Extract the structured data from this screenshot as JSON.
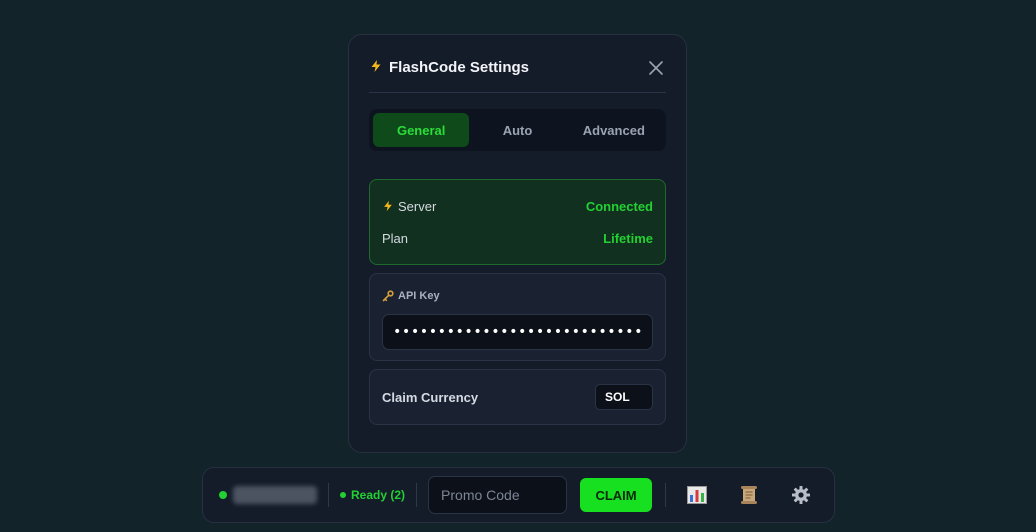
{
  "modal": {
    "title": "FlashCode Settings",
    "tabs": [
      {
        "label": "General",
        "active": true
      },
      {
        "label": "Auto",
        "active": false
      },
      {
        "label": "Advanced",
        "active": false
      }
    ],
    "status": {
      "server_label": "Server",
      "server_value": "Connected",
      "plan_label": "Plan",
      "plan_value": "Lifetime"
    },
    "api": {
      "label": "API Key",
      "value": "••••••••••••••••••••••••••••••••••••"
    },
    "currency": {
      "label": "Claim Currency",
      "value": "SOL"
    }
  },
  "bar": {
    "username": "hiddenuser",
    "ready_text": "Ready (2)",
    "promo_placeholder": "Promo Code",
    "claim_label": "CLAIM"
  },
  "colors": {
    "accent": "#16e01f",
    "background": "#13232a",
    "panel": "#141b29"
  },
  "icons": [
    "lightning-icon",
    "close-icon",
    "key-icon",
    "chart-icon",
    "scroll-icon",
    "gear-icon"
  ]
}
